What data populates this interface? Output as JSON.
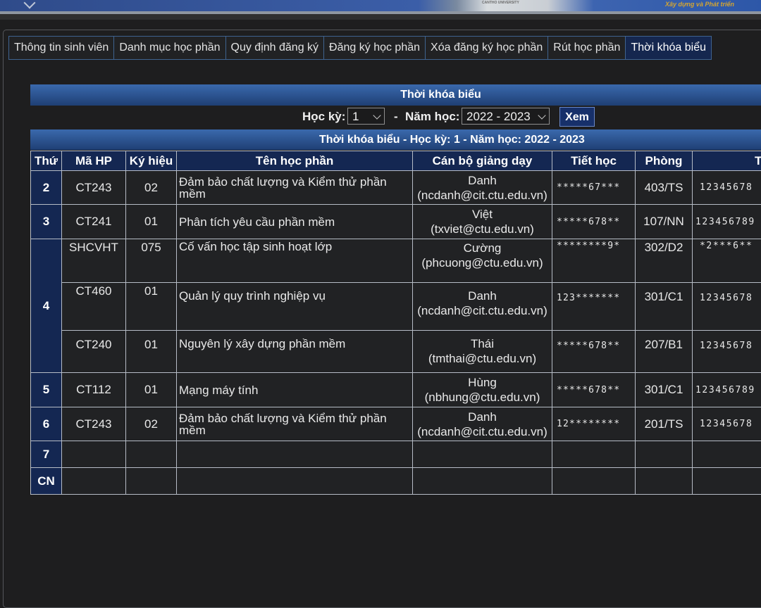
{
  "banner": {
    "caption": "CANTHO UNIVERSITY",
    "slogan": "Xây dựng và Phát triển"
  },
  "tabs": [
    {
      "label": "Thông tin sinh viên"
    },
    {
      "label": "Danh mục học phần"
    },
    {
      "label": "Quy định đăng ký"
    },
    {
      "label": "Đăng ký học phần"
    },
    {
      "label": "Xóa đăng ký học phần"
    },
    {
      "label": "Rút học phần"
    },
    {
      "label": "Thời khóa biểu",
      "active": true
    }
  ],
  "page": {
    "title": "Thời khóa biểu",
    "hoc_ky_label": "Học kỳ:",
    "hoc_ky_value": "1",
    "separator": "-",
    "nam_hoc_label": "Năm học:",
    "nam_hoc_value": "2022 - 2023",
    "xem_label": "Xem",
    "table_caption": "Thời khóa biểu - Học kỳ: 1 - Năm học: 2022 - 2023"
  },
  "table": {
    "headers": {
      "thu": "Thứ",
      "ma_hp": "Mã HP",
      "ky_hieu": "Ký hiệu",
      "ten_hp": "Tên học phần",
      "can_bo": "Cán bộ giảng dạy",
      "tiet_hoc": "Tiết học",
      "phong": "Phòng",
      "tuan": "T"
    },
    "days": [
      "2",
      "3",
      "4",
      "5",
      "6",
      "7",
      "CN"
    ],
    "rows": [
      {
        "ma_hp": "CT243",
        "ky_hieu": "02",
        "ten_hp": "Đảm bảo chất lượng và Kiểm thử phần mềm",
        "gv_name": "Danh",
        "gv_email": "(ncdanh@cit.ctu.edu.vn)",
        "tiet": "*****67***",
        "phong": "403/TS",
        "tuan": "12345678"
      },
      {
        "ma_hp": "CT241",
        "ky_hieu": "01",
        "ten_hp": "Phân tích yêu cầu phần mềm",
        "gv_name": "Việt",
        "gv_email": "(txviet@ctu.edu.vn)",
        "tiet": "*****678**",
        "phong": "107/NN",
        "tuan": "123456789"
      },
      {
        "ma_hp": "SHCVHT",
        "ky_hieu": "075",
        "ten_hp": "Cố vấn học tập sinh hoạt lớp",
        "gv_name": "Cường",
        "gv_email": "(phcuong@ctu.edu.vn)",
        "tiet": "********9*",
        "phong": "302/D2",
        "tuan": "*2***6**"
      },
      {
        "ma_hp": "CT460",
        "ky_hieu": "01",
        "ten_hp": "Quản lý quy trình nghiệp vụ",
        "gv_name": "Danh",
        "gv_email": "(ncdanh@cit.ctu.edu.vn)",
        "tiet": "123*******",
        "phong": "301/C1",
        "tuan": "12345678"
      },
      {
        "ma_hp": "CT240",
        "ky_hieu": "01",
        "ten_hp": "Nguyên lý xây dựng phần mềm",
        "gv_name": "Thái",
        "gv_email": "(tmthai@ctu.edu.vn)",
        "tiet": "*****678**",
        "phong": "207/B1",
        "tuan": "12345678"
      },
      {
        "ma_hp": "CT112",
        "ky_hieu": "01",
        "ten_hp": "Mạng máy tính",
        "gv_name": "Hùng",
        "gv_email": "(nbhung@ctu.edu.vn)",
        "tiet": "*****678**",
        "phong": "301/C1",
        "tuan": "123456789"
      },
      {
        "ma_hp": "CT243",
        "ky_hieu": "02",
        "ten_hp": "Đảm bảo chất lượng và Kiểm thử phần mềm",
        "gv_name": "Danh",
        "gv_email": "(ncdanh@cit.ctu.edu.vn)",
        "tiet": "12********",
        "phong": "201/TS",
        "tuan": "12345678"
      }
    ]
  }
}
